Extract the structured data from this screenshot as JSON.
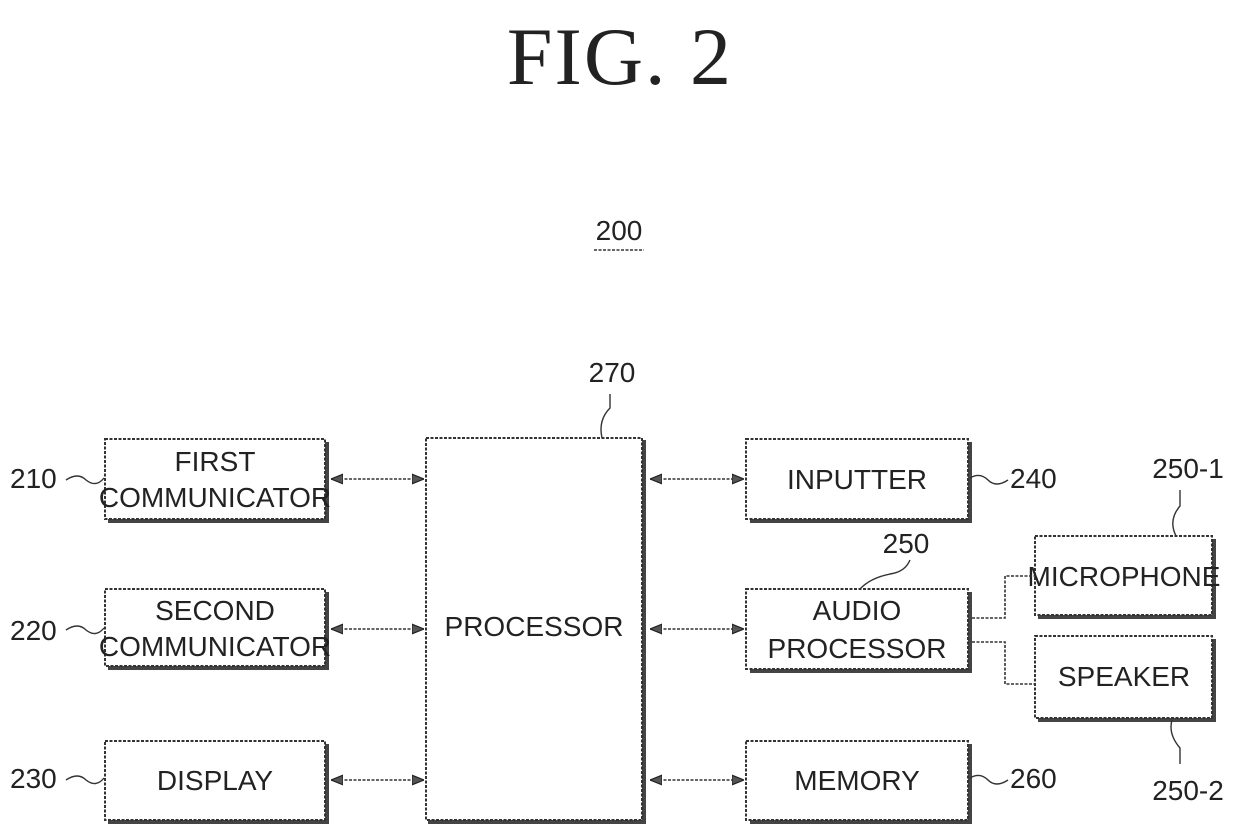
{
  "figure": {
    "title": "FIG. 2",
    "system_ref": "200"
  },
  "blocks": {
    "processor": {
      "ref": "270",
      "label": [
        "PROCESSOR"
      ]
    },
    "first_communicator": {
      "ref": "210",
      "label": [
        "FIRST",
        "COMMUNICATOR"
      ]
    },
    "second_communicator": {
      "ref": "220",
      "label": [
        "SECOND",
        "COMMUNICATOR"
      ]
    },
    "display": {
      "ref": "230",
      "label": [
        "DISPLAY"
      ]
    },
    "inputter": {
      "ref": "240",
      "label": [
        "INPUTTER"
      ]
    },
    "audio_processor": {
      "ref": "250",
      "label": [
        "AUDIO",
        "PROCESSOR"
      ]
    },
    "memory": {
      "ref": "260",
      "label": [
        "MEMORY"
      ]
    },
    "microphone": {
      "ref": "250-1",
      "label": [
        "MICROPHONE"
      ]
    },
    "speaker": {
      "ref": "250-2",
      "label": [
        "SPEAKER"
      ]
    }
  },
  "connections": [
    {
      "from": "first_communicator",
      "to": "processor",
      "type": "bidirectional"
    },
    {
      "from": "second_communicator",
      "to": "processor",
      "type": "bidirectional"
    },
    {
      "from": "display",
      "to": "processor",
      "type": "bidirectional"
    },
    {
      "from": "processor",
      "to": "inputter",
      "type": "bidirectional"
    },
    {
      "from": "processor",
      "to": "audio_processor",
      "type": "bidirectional"
    },
    {
      "from": "processor",
      "to": "memory",
      "type": "bidirectional"
    },
    {
      "from": "audio_processor",
      "to": "microphone",
      "type": "line"
    },
    {
      "from": "audio_processor",
      "to": "speaker",
      "type": "line"
    }
  ]
}
